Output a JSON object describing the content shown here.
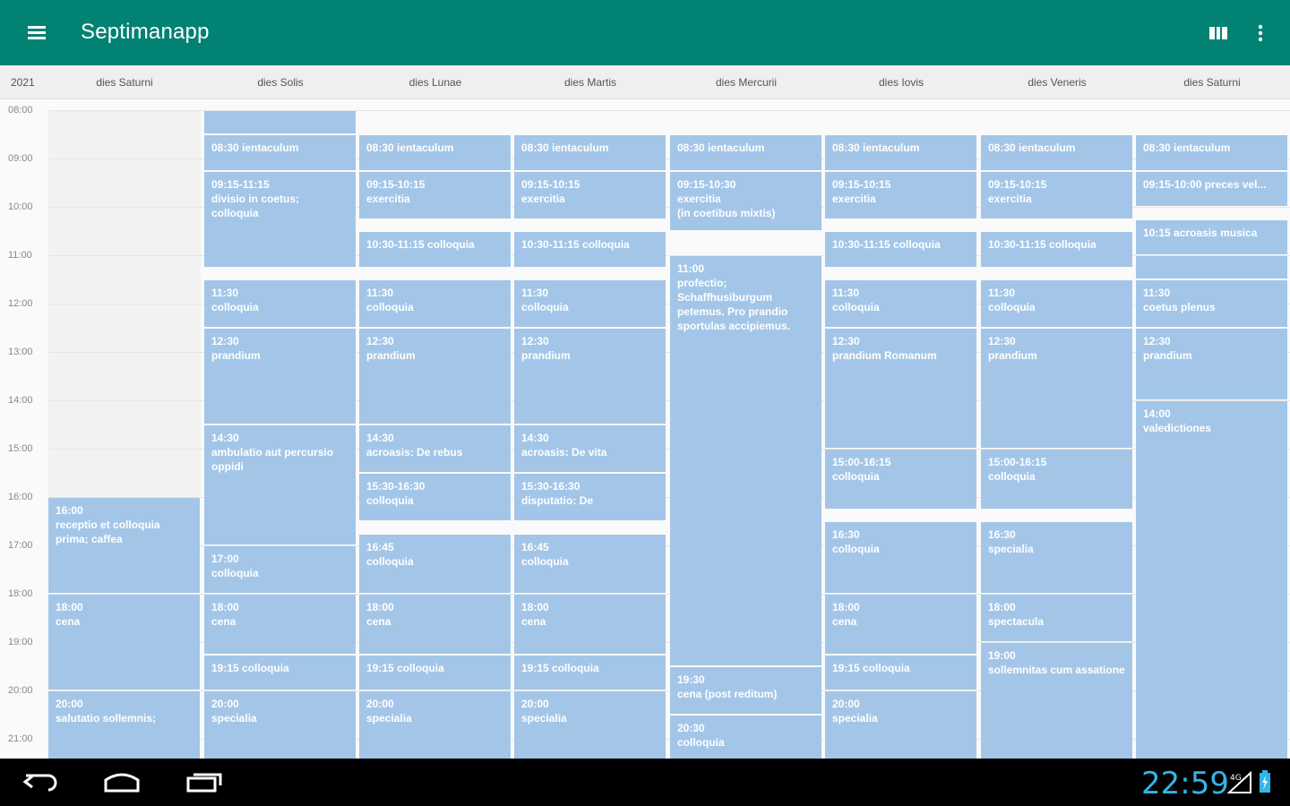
{
  "app": {
    "title": "Septimanapp"
  },
  "header": {
    "year": "2021",
    "days": [
      "dies Saturni",
      "dies Solis",
      "dies Lunae",
      "dies Martis",
      "dies Mercurii",
      "dies Iovis",
      "dies Veneris",
      "dies Saturni"
    ]
  },
  "hours": [
    "08:00",
    "09:00",
    "10:00",
    "11:00",
    "12:00",
    "13:00",
    "14:00",
    "15:00",
    "16:00",
    "17:00",
    "18:00",
    "19:00",
    "20:00",
    "21:00"
  ],
  "events": [
    {
      "day": 0,
      "start": 16.0,
      "end": 18.0,
      "text": "16:00\nreceptio et colloquia prima; caffea"
    },
    {
      "day": 0,
      "start": 18.0,
      "end": 20.0,
      "text": "18:00\ncena"
    },
    {
      "day": 0,
      "start": 20.0,
      "end": 21.5,
      "text": "20:00\nsalutatio sollemnis;"
    },
    {
      "day": 1,
      "start": 8.0,
      "end": 8.5,
      "text": ""
    },
    {
      "day": 1,
      "start": 8.5,
      "end": 9.25,
      "text": "08:30 ientaculum"
    },
    {
      "day": 1,
      "start": 9.25,
      "end": 11.25,
      "text": "09:15-11:15\ndivisio in coetus; colloquia"
    },
    {
      "day": 1,
      "start": 11.5,
      "end": 12.5,
      "text": "11:30\ncolloquia"
    },
    {
      "day": 1,
      "start": 12.5,
      "end": 14.5,
      "text": "12:30\nprandium"
    },
    {
      "day": 1,
      "start": 14.5,
      "end": 17.0,
      "text": "14:30\nambulatio aut percursio oppidi"
    },
    {
      "day": 1,
      "start": 17.0,
      "end": 18.0,
      "text": "17:00\ncolloquia"
    },
    {
      "day": 1,
      "start": 18.0,
      "end": 19.25,
      "text": "18:00\ncena"
    },
    {
      "day": 1,
      "start": 19.25,
      "end": 20.0,
      "text": "19:15 colloquia"
    },
    {
      "day": 1,
      "start": 20.0,
      "end": 21.5,
      "text": "20:00\nspecialia"
    },
    {
      "day": 2,
      "start": 8.5,
      "end": 9.25,
      "text": "08:30 ientaculum"
    },
    {
      "day": 2,
      "start": 9.25,
      "end": 10.25,
      "text": "09:15-10:15\nexercitia"
    },
    {
      "day": 2,
      "start": 10.5,
      "end": 11.25,
      "text": "10:30-11:15 colloquia"
    },
    {
      "day": 2,
      "start": 11.5,
      "end": 12.5,
      "text": "11:30\ncolloquia"
    },
    {
      "day": 2,
      "start": 12.5,
      "end": 14.5,
      "text": "12:30\nprandium"
    },
    {
      "day": 2,
      "start": 14.5,
      "end": 15.5,
      "text": "14:30\nacroasis: De rebus"
    },
    {
      "day": 2,
      "start": 15.5,
      "end": 16.5,
      "text": "15:30-16:30\ncolloquia"
    },
    {
      "day": 2,
      "start": 16.75,
      "end": 18.0,
      "text": "16:45\ncolloquia"
    },
    {
      "day": 2,
      "start": 18.0,
      "end": 19.25,
      "text": "18:00\ncena"
    },
    {
      "day": 2,
      "start": 19.25,
      "end": 20.0,
      "text": "19:15 colloquia"
    },
    {
      "day": 2,
      "start": 20.0,
      "end": 21.5,
      "text": "20:00\nspecialia"
    },
    {
      "day": 3,
      "start": 8.5,
      "end": 9.25,
      "text": "08:30 ientaculum"
    },
    {
      "day": 3,
      "start": 9.25,
      "end": 10.25,
      "text": "09:15-10:15\nexercitia"
    },
    {
      "day": 3,
      "start": 10.5,
      "end": 11.25,
      "text": "10:30-11:15 colloquia"
    },
    {
      "day": 3,
      "start": 11.5,
      "end": 12.5,
      "text": "11:30\ncolloquia"
    },
    {
      "day": 3,
      "start": 12.5,
      "end": 14.5,
      "text": "12:30\nprandium"
    },
    {
      "day": 3,
      "start": 14.5,
      "end": 15.5,
      "text": "14:30\nacroasis: De vita"
    },
    {
      "day": 3,
      "start": 15.5,
      "end": 16.5,
      "text": "15:30-16:30\ndisputatio: De"
    },
    {
      "day": 3,
      "start": 16.75,
      "end": 18.0,
      "text": "16:45\ncolloquia"
    },
    {
      "day": 3,
      "start": 18.0,
      "end": 19.25,
      "text": "18:00\ncena"
    },
    {
      "day": 3,
      "start": 19.25,
      "end": 20.0,
      "text": "19:15 colloquia"
    },
    {
      "day": 3,
      "start": 20.0,
      "end": 21.5,
      "text": "20:00\nspecialia"
    },
    {
      "day": 4,
      "start": 8.5,
      "end": 9.25,
      "text": "08:30 ientaculum"
    },
    {
      "day": 4,
      "start": 9.25,
      "end": 10.5,
      "text": "09:15-10:30\nexercitia\n(in coetibus mixtis)"
    },
    {
      "day": 4,
      "start": 11.0,
      "end": 19.5,
      "text": "11:00\nprofectio; Schaffhusiburgum petemus. Pro prandio sportulas accipiemus."
    },
    {
      "day": 4,
      "start": 19.5,
      "end": 20.5,
      "text": "19:30\ncena (post reditum)"
    },
    {
      "day": 4,
      "start": 20.5,
      "end": 21.5,
      "text": "20:30\ncolloquia"
    },
    {
      "day": 5,
      "start": 8.5,
      "end": 9.25,
      "text": "08:30 ientaculum"
    },
    {
      "day": 5,
      "start": 9.25,
      "end": 10.25,
      "text": "09:15-10:15\nexercitia"
    },
    {
      "day": 5,
      "start": 10.5,
      "end": 11.25,
      "text": "10:30-11:15 colloquia"
    },
    {
      "day": 5,
      "start": 11.5,
      "end": 12.5,
      "text": "11:30\ncolloquia"
    },
    {
      "day": 5,
      "start": 12.5,
      "end": 15.0,
      "text": "12:30\nprandium Romanum"
    },
    {
      "day": 5,
      "start": 15.0,
      "end": 16.25,
      "text": "15:00-16:15\ncolloquia"
    },
    {
      "day": 5,
      "start": 16.5,
      "end": 18.0,
      "text": "16:30\ncolloquia"
    },
    {
      "day": 5,
      "start": 18.0,
      "end": 19.25,
      "text": "18:00\ncena"
    },
    {
      "day": 5,
      "start": 19.25,
      "end": 20.0,
      "text": "19:15 colloquia"
    },
    {
      "day": 5,
      "start": 20.0,
      "end": 21.5,
      "text": "20:00\nspecialia"
    },
    {
      "day": 6,
      "start": 8.5,
      "end": 9.25,
      "text": "08:30 ientaculum"
    },
    {
      "day": 6,
      "start": 9.25,
      "end": 10.25,
      "text": "09:15-10:15\nexercitia"
    },
    {
      "day": 6,
      "start": 10.5,
      "end": 11.25,
      "text": "10:30-11:15 colloquia"
    },
    {
      "day": 6,
      "start": 11.5,
      "end": 12.5,
      "text": "11:30\ncolloquia"
    },
    {
      "day": 6,
      "start": 12.5,
      "end": 15.0,
      "text": "12:30\nprandium"
    },
    {
      "day": 6,
      "start": 15.0,
      "end": 16.25,
      "text": "15:00-16:15\ncolloquia"
    },
    {
      "day": 6,
      "start": 16.5,
      "end": 18.0,
      "text": "16:30\nspecialia"
    },
    {
      "day": 6,
      "start": 18.0,
      "end": 19.0,
      "text": "18:00\nspectacula"
    },
    {
      "day": 6,
      "start": 19.0,
      "end": 21.5,
      "text": "19:00\nsollemnitas cum assatione"
    },
    {
      "day": 7,
      "start": 8.5,
      "end": 9.25,
      "text": "08:30 ientaculum"
    },
    {
      "day": 7,
      "start": 9.25,
      "end": 10.0,
      "text": "09:15-10:00 preces vel..."
    },
    {
      "day": 7,
      "start": 10.25,
      "end": 11.0,
      "text": "10:15 acroasis musica"
    },
    {
      "day": 7,
      "start": 11.0,
      "end": 11.5,
      "text": ""
    },
    {
      "day": 7,
      "start": 11.5,
      "end": 12.5,
      "text": "11:30\ncoetus plenus"
    },
    {
      "day": 7,
      "start": 12.5,
      "end": 14.0,
      "text": "12:30\nprandium"
    },
    {
      "day": 7,
      "start": 14.0,
      "end": 21.5,
      "text": "14:00\nvaledictiones"
    }
  ],
  "statusbar": {
    "clock": "22:59",
    "network": "4G"
  }
}
